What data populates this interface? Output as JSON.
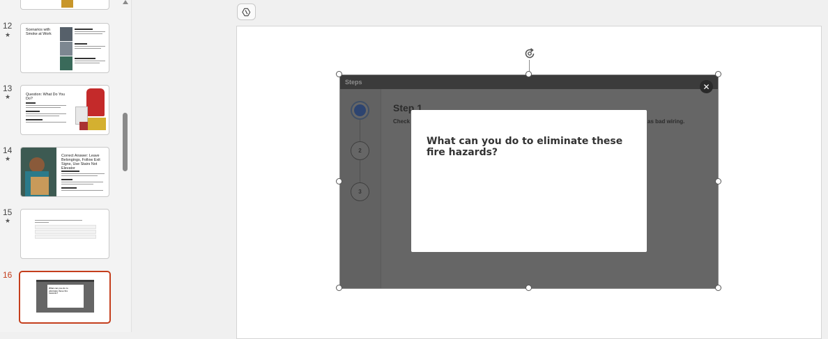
{
  "slides": [
    {
      "number": "12",
      "starred": true,
      "title": "Scenarios with Smoke at Work",
      "active": false
    },
    {
      "number": "13",
      "starred": true,
      "title": "Question: What Do You Do?",
      "active": false
    },
    {
      "number": "14",
      "starred": true,
      "title": "Correct Answer: Leave Belongings, Follow Exit Signs, Use Stairs Not Elevator",
      "active": false
    },
    {
      "number": "15",
      "starred": true,
      "title": "",
      "active": false
    },
    {
      "number": "16",
      "starred": false,
      "title": "What can you do to eliminate these fire hazards?",
      "active": true
    }
  ],
  "star_glyph": "★",
  "embed": {
    "header_label": "Steps",
    "step_title": "Step 1",
    "step_text_left": "Check",
    "step_text_right": "as bad wiring.",
    "steps": [
      "1",
      "2",
      "3"
    ],
    "close_glyph": "✕"
  },
  "dialog": {
    "question": "What can you do to eliminate these fire hazards?"
  },
  "icons": {
    "copilot": "copilot-icon",
    "rotate": "rotate-icon"
  },
  "colors": {
    "active_slide_accent": "#c43e1c",
    "embed_background": "#666666",
    "dialog_background": "#ffffff"
  }
}
